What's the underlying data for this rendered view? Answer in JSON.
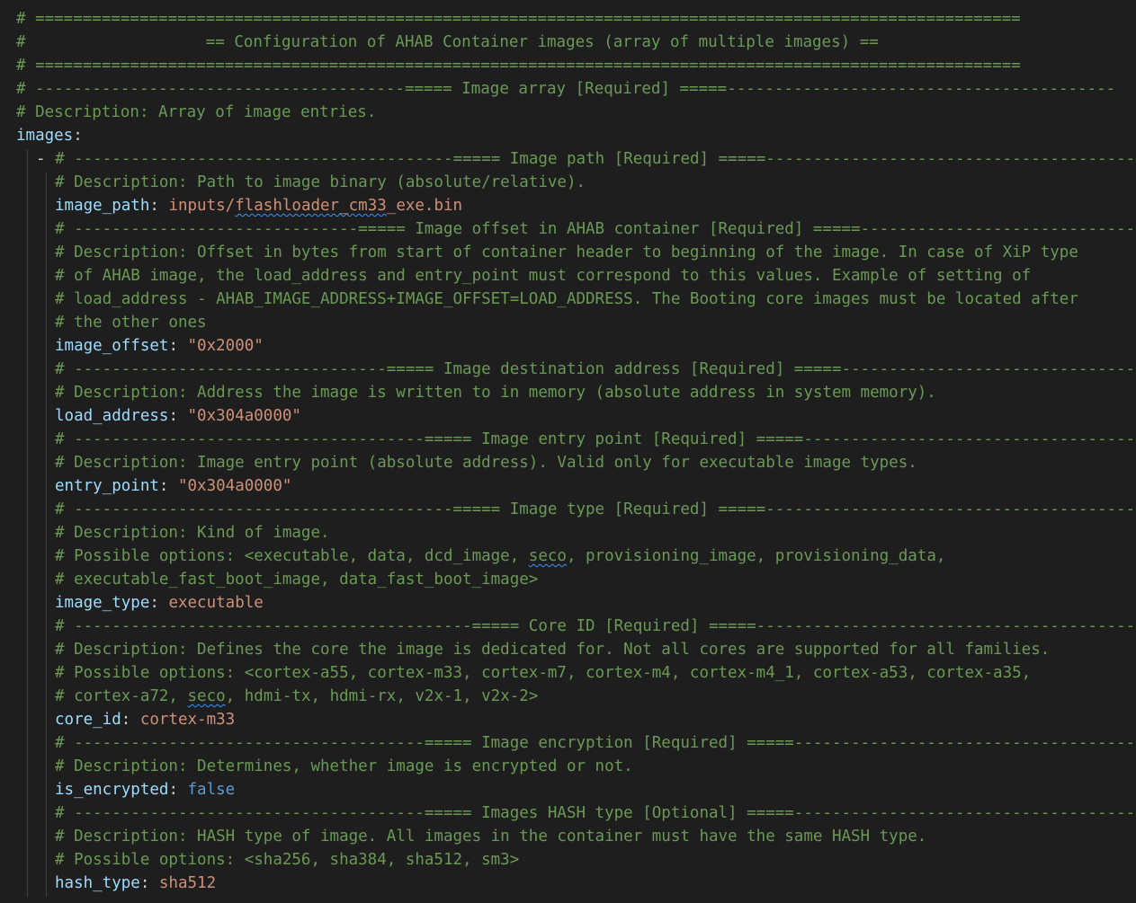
{
  "header": {
    "rule": "# ========================================================================================================",
    "title": "#                   == Configuration of AHAB Container images (array of multiple images) =="
  },
  "image_array": {
    "section": "# ---------------------------------------===== Image array [Required] =====-----------------------------------------",
    "description": "# Description: Array of image entries.",
    "key": "images"
  },
  "image_path": {
    "dash": "- ",
    "section": "# ----------------------------------------===== Image path [Required] =====---------------------------------------",
    "description": "# Description: Path to image binary (absolute/relative).",
    "key": "image_path",
    "value_prefix": "inputs/",
    "value_squiggle": "flashloader_cm33",
    "value_suffix": "_exe.bin"
  },
  "image_offset": {
    "section": "# ------------------------------===== Image offset in AHAB container [Required] =====-------------------------------",
    "description_lines": [
      "# Description: Offset in bytes from start of container header to beginning of the image. In case of XiP type",
      "# of AHAB image, the load_address and entry_point must correspond to this values. Example of setting of",
      "# load_address - AHAB_IMAGE_ADDRESS+IMAGE_OFFSET=LOAD_ADDRESS. The Booting core images must be located after",
      "# the other ones"
    ],
    "key": "image_offset",
    "value": "\"0x2000\""
  },
  "load_address": {
    "section": "# ---------------------------------===== Image destination address [Required] =====----------------------------------",
    "description": "# Description: Address the image is written to in memory (absolute address in system memory).",
    "key": "load_address",
    "value": "\"0x304a0000\""
  },
  "entry_point": {
    "section": "# -------------------------------------===== Image entry point [Required] =====--------------------------------------",
    "description": "# Description: Image entry point (absolute address). Valid only for executable image types.",
    "key": "entry_point",
    "value": "\"0x304a0000\""
  },
  "image_type": {
    "section": "# ----------------------------------------===== Image type [Required] =====---------------------------------------",
    "description": "# Description: Kind of image.",
    "options_line1_prefix": "# Possible options: <executable, data, dcd_image, ",
    "options_line1_squiggle": "seco",
    "options_line1_suffix": ", provisioning_image, provisioning_data,",
    "options_line2": "# executable_fast_boot_image, data_fast_boot_image>",
    "key": "image_type",
    "value": "executable"
  },
  "core_id": {
    "section": "# ------------------------------------------===== Core ID [Required] =====------------------------------------------",
    "description": "# Description: Defines the core the image is dedicated for. Not all cores are supported for all families.",
    "options_line1": "# Possible options: <cortex-a55, cortex-m33, cortex-m7, cortex-m4, cortex-m4_1, cortex-a53, cortex-a35,",
    "options_line2_prefix": "# cortex-a72, ",
    "options_line2_squiggle": "seco",
    "options_line2_suffix": ", hdmi-tx, hdmi-rx, v2x-1, v2x-2>",
    "key": "core_id",
    "value": "cortex-m33"
  },
  "is_encrypted": {
    "section": "# -------------------------------------===== Image encryption [Required] =====-------------------------------------",
    "description": "# Description: Determines, whether image is encrypted or not.",
    "key": "is_encrypted",
    "value": "false"
  },
  "hash_type": {
    "section": "# -------------------------------------===== Images HASH type [Optional] =====-------------------------------------",
    "description": "# Description: HASH type of image. All images in the container must have the same HASH type.",
    "options": "# Possible options: <sha256, sha384, sha512, sm3>",
    "key": "hash_type",
    "value": "sha512"
  },
  "colors": {
    "background": "#1e1e1e",
    "comment": "#6a9955",
    "key": "#9cdcfe",
    "string": "#ce9178",
    "boolean": "#569cd6",
    "squiggle": "#3794ff"
  }
}
